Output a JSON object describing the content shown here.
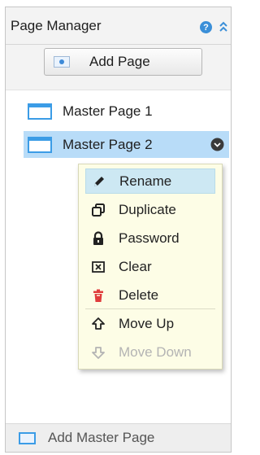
{
  "panel": {
    "title": "Page Manager",
    "help_icon": "help-icon",
    "help_glyph": "?",
    "collapse_icon": "double-chevron-up-icon"
  },
  "toolbar": {
    "add_page_label": "Add Page",
    "add_page_icon": "add-page-icon"
  },
  "pages": [
    {
      "label": "Master Page 1",
      "icon": "page-icon",
      "selected": false
    },
    {
      "label": "Master Page 2",
      "icon": "page-icon",
      "selected": true
    }
  ],
  "context_menu": {
    "items": [
      {
        "label": "Rename",
        "icon": "pencil-icon",
        "state": "hover"
      },
      {
        "label": "Duplicate",
        "icon": "duplicate-icon",
        "state": "normal"
      },
      {
        "label": "Password",
        "icon": "lock-icon",
        "state": "normal"
      },
      {
        "label": "Clear",
        "icon": "clear-icon",
        "state": "normal"
      },
      {
        "label": "Delete",
        "icon": "trash-icon",
        "state": "normal"
      },
      {
        "label": "Move Up",
        "icon": "arrow-up-icon",
        "state": "normal"
      },
      {
        "label": "Move Down",
        "icon": "arrow-down-icon",
        "state": "disabled"
      }
    ]
  },
  "footer": {
    "label": "Add Master Page",
    "icon": "master-page-icon"
  },
  "colors": {
    "accent": "#3b9ce6",
    "selection": "#b8dcf8",
    "menu_background": "#fdfde6",
    "menu_hover": "#cde8f3",
    "delete_red": "#e03c3c",
    "disabled_text": "#b4b4b4"
  }
}
